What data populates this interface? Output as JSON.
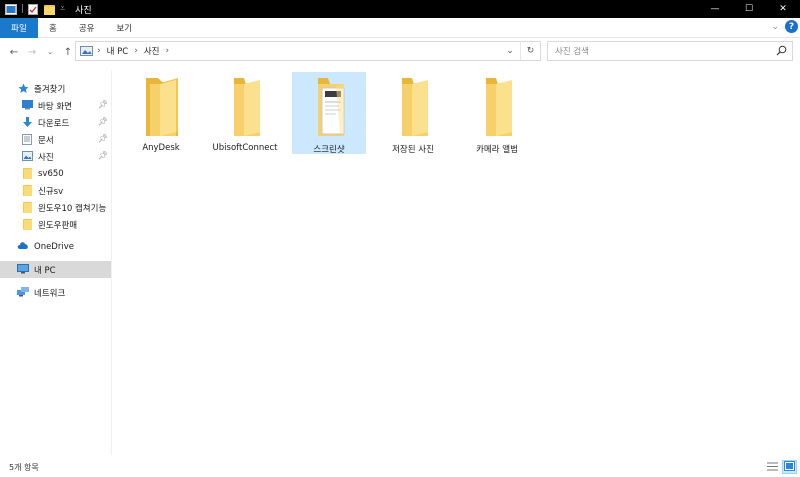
{
  "window": {
    "title": "사진",
    "controls": {
      "minimize": "—",
      "maximize": "☐",
      "close": "✕"
    }
  },
  "ribbon": {
    "tabs": [
      "파일",
      "홈",
      "공유",
      "보기"
    ],
    "help": "?"
  },
  "address": {
    "crumbs": [
      "내 PC",
      "사진"
    ]
  },
  "search": {
    "placeholder": "사진 검색"
  },
  "sidebar": {
    "quick_access": "즐겨찾기",
    "items": [
      {
        "label": "바탕 화면",
        "icon": "desktop-icon",
        "pinned": true
      },
      {
        "label": "다운로드",
        "icon": "download-icon",
        "pinned": true
      },
      {
        "label": "문서",
        "icon": "document-icon",
        "pinned": true
      },
      {
        "label": "사진",
        "icon": "pictures-icon",
        "pinned": true
      },
      {
        "label": "sv650",
        "icon": "folder-icon",
        "pinned": false
      },
      {
        "label": "신규sv",
        "icon": "folder-icon",
        "pinned": false
      },
      {
        "label": "윈도우10 캡쳐기능",
        "icon": "folder-icon",
        "pinned": false
      },
      {
        "label": "윈도우판매",
        "icon": "folder-icon",
        "pinned": false
      }
    ],
    "onedrive": "OneDrive",
    "this_pc": "내 PC",
    "network": "네트워크"
  },
  "content": {
    "folders": [
      {
        "label": "AnyDesk",
        "selected": false,
        "thumbnail": false
      },
      {
        "label": "UbisoftConnect",
        "selected": false,
        "thumbnail": false
      },
      {
        "label": "스크린샷",
        "selected": true,
        "thumbnail": true
      },
      {
        "label": "저장된 사진",
        "selected": false,
        "thumbnail": false
      },
      {
        "label": "카메라 앨범",
        "selected": false,
        "thumbnail": false
      }
    ]
  },
  "status": {
    "item_count": "5개 항목"
  },
  "colors": {
    "accent": "#1979ca",
    "selection": "#cce8ff",
    "folder": "#f7d26a",
    "titlebar": "#000000"
  }
}
